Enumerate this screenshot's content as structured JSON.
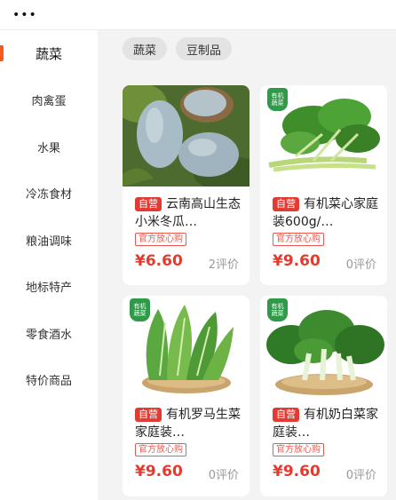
{
  "topbar": {
    "menu_glyph": "•••"
  },
  "sidebar": {
    "accent_color": "#f25c1e",
    "items": [
      {
        "label": "蔬菜",
        "active": true
      },
      {
        "label": "肉禽蛋",
        "active": false
      },
      {
        "label": "水果",
        "active": false
      },
      {
        "label": "冷冻食材",
        "active": false
      },
      {
        "label": "粮油调味",
        "active": false
      },
      {
        "label": "地标特产",
        "active": false
      },
      {
        "label": "零食酒水",
        "active": false
      },
      {
        "label": "特价商品",
        "active": false
      }
    ]
  },
  "filters": {
    "chips": [
      "蔬菜",
      "豆制品"
    ]
  },
  "products": [
    {
      "self_badge": "自营",
      "title": "云南高山生态小米冬瓜…",
      "official_badge": "官方放心购",
      "price": "¥6.60",
      "reviews": "2评价",
      "organic_label": ""
    },
    {
      "self_badge": "自营",
      "title": "有机菜心家庭装600g/…",
      "official_badge": "官方放心购",
      "price": "¥9.60",
      "reviews": "0评价",
      "organic_label": "有机蔬菜"
    },
    {
      "self_badge": "自营",
      "title": "有机罗马生菜家庭装…",
      "official_badge": "官方放心购",
      "price": "¥9.60",
      "reviews": "0评价",
      "organic_label": "有机蔬菜"
    },
    {
      "self_badge": "自营",
      "title": "有机奶白菜家庭装…",
      "official_badge": "官方放心购",
      "price": "¥9.60",
      "reviews": "0评价",
      "organic_label": "有机蔬菜"
    }
  ],
  "colors": {
    "price": "#e43b30",
    "self_badge": "#e13b33",
    "organic_badge": "#2f9a48"
  }
}
